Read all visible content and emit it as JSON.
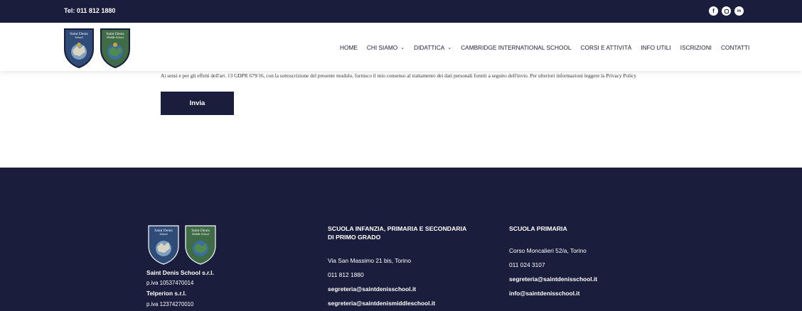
{
  "topbar": {
    "phone": "Tel: 011 812 1880",
    "social": [
      {
        "icon": "facebook-icon",
        "glyph": "f"
      },
      {
        "icon": "instagram-icon",
        "glyph": ""
      },
      {
        "icon": "linkedin-icon",
        "glyph": "in"
      }
    ]
  },
  "logos": {
    "left": {
      "line1": "Saint Denis",
      "line2": "School"
    },
    "right": {
      "line1": "Saint Denis",
      "line2": "Middle School"
    }
  },
  "nav": {
    "items": [
      {
        "label": "HOME",
        "has_dropdown": false
      },
      {
        "label": "CHI SIAMO",
        "has_dropdown": true
      },
      {
        "label": "DIDATTICA",
        "has_dropdown": true
      },
      {
        "label": "CAMBRIDGE INTERNATIONAL SCHOOL",
        "has_dropdown": false
      },
      {
        "label": "CORSI E ATTIVITÀ",
        "has_dropdown": false
      },
      {
        "label": "INFO UTILI",
        "has_dropdown": false
      },
      {
        "label": "ISCRIZIONI",
        "has_dropdown": false
      },
      {
        "label": "CONTATTI",
        "has_dropdown": false
      }
    ]
  },
  "form": {
    "consent_text": "Ai sensi e per gli effetti dell'art. 13 GDPR 679/16, con la sottoscrizione del presente modulo, fornisco il mio consenso al trattamento dei dati personali forniti a seguito dell'invio. Per ulteriori informazioni leggere la Privacy Policy",
    "submit_label": "Invia"
  },
  "footer": {
    "company": {
      "name1": "Saint Denis School s.r.l.",
      "vat1": "p.iva 10537470014",
      "name2": "Telperion s.r.l.",
      "vat2": "p.iva 12374270010"
    },
    "col1": {
      "heading_line1": "SCUOLA INFANZIA, PRIMARIA E SECONDARIA",
      "heading_line2": "DI PRIMO GRADO",
      "address": "Via San Massimo 21 bis, Torino",
      "phone": "011 812 1880",
      "email1": "segreteria@saintdenisschool.it",
      "email2": "segreteria@saintdenismiddleschool.it"
    },
    "col2": {
      "heading": "SCUOLA PRIMARIA",
      "address": "Corso Moncalieri 52/a, Torino",
      "phone": "011 024 3107",
      "email1": "segreteria@saintdenisschool.it",
      "email2": "info@saintdenisschool.it"
    }
  },
  "colors": {
    "navy": "#1b1d3d",
    "white": "#ffffff",
    "crest_green": "#3f6b47",
    "crest_blue": "#2f4b78"
  }
}
